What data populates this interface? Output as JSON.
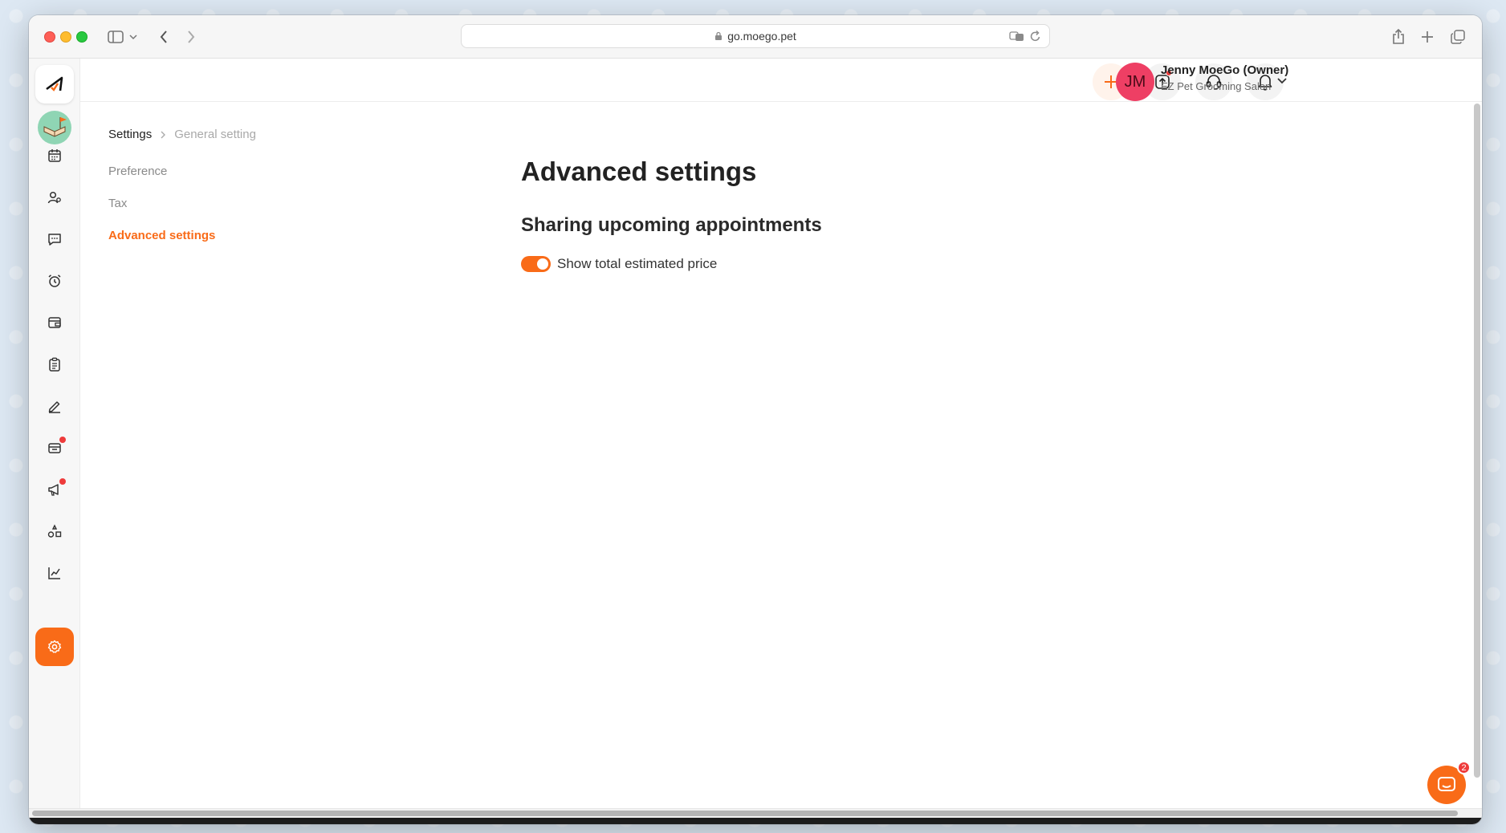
{
  "browser": {
    "url": "go.moego.pet"
  },
  "sidebar": {
    "items": [
      {
        "name": "logo",
        "icon": "moego-logo-icon"
      },
      {
        "name": "workspace-avatar",
        "icon": "book-flag-icon"
      },
      {
        "name": "calendar",
        "icon": "calendar-icon"
      },
      {
        "name": "clients",
        "icon": "clients-icon"
      },
      {
        "name": "messages",
        "icon": "message-icon"
      },
      {
        "name": "reminders",
        "icon": "alarm-icon"
      },
      {
        "name": "payments",
        "icon": "wallet-icon"
      },
      {
        "name": "reports-list",
        "icon": "clipboard-icon"
      },
      {
        "name": "agreements",
        "icon": "pen-icon"
      },
      {
        "name": "retail",
        "icon": "retail-icon"
      },
      {
        "name": "marketing",
        "icon": "megaphone-icon"
      },
      {
        "name": "services",
        "icon": "services-icon"
      },
      {
        "name": "insights",
        "icon": "chart-icon"
      },
      {
        "name": "settings",
        "icon": "gear-icon"
      }
    ]
  },
  "header": {
    "user_initials": "JM",
    "user_name": "Jenny MoeGo (Owner)",
    "business_name": "EZ Pet Grooming Salon"
  },
  "breadcrumb": {
    "root": "Settings",
    "current": "General setting"
  },
  "subnav": {
    "items": [
      {
        "label": "Preference",
        "active": false
      },
      {
        "label": "Tax",
        "active": false
      },
      {
        "label": "Advanced settings",
        "active": true
      }
    ]
  },
  "main": {
    "title": "Advanced settings",
    "section_title": "Sharing upcoming appointments",
    "toggle": {
      "label": "Show total estimated price",
      "on": true
    }
  },
  "chat": {
    "badge_count": "2"
  },
  "colors": {
    "accent": "#f96b18",
    "avatar": "#ee3f64",
    "notification_dot": "#ee3b3b"
  }
}
